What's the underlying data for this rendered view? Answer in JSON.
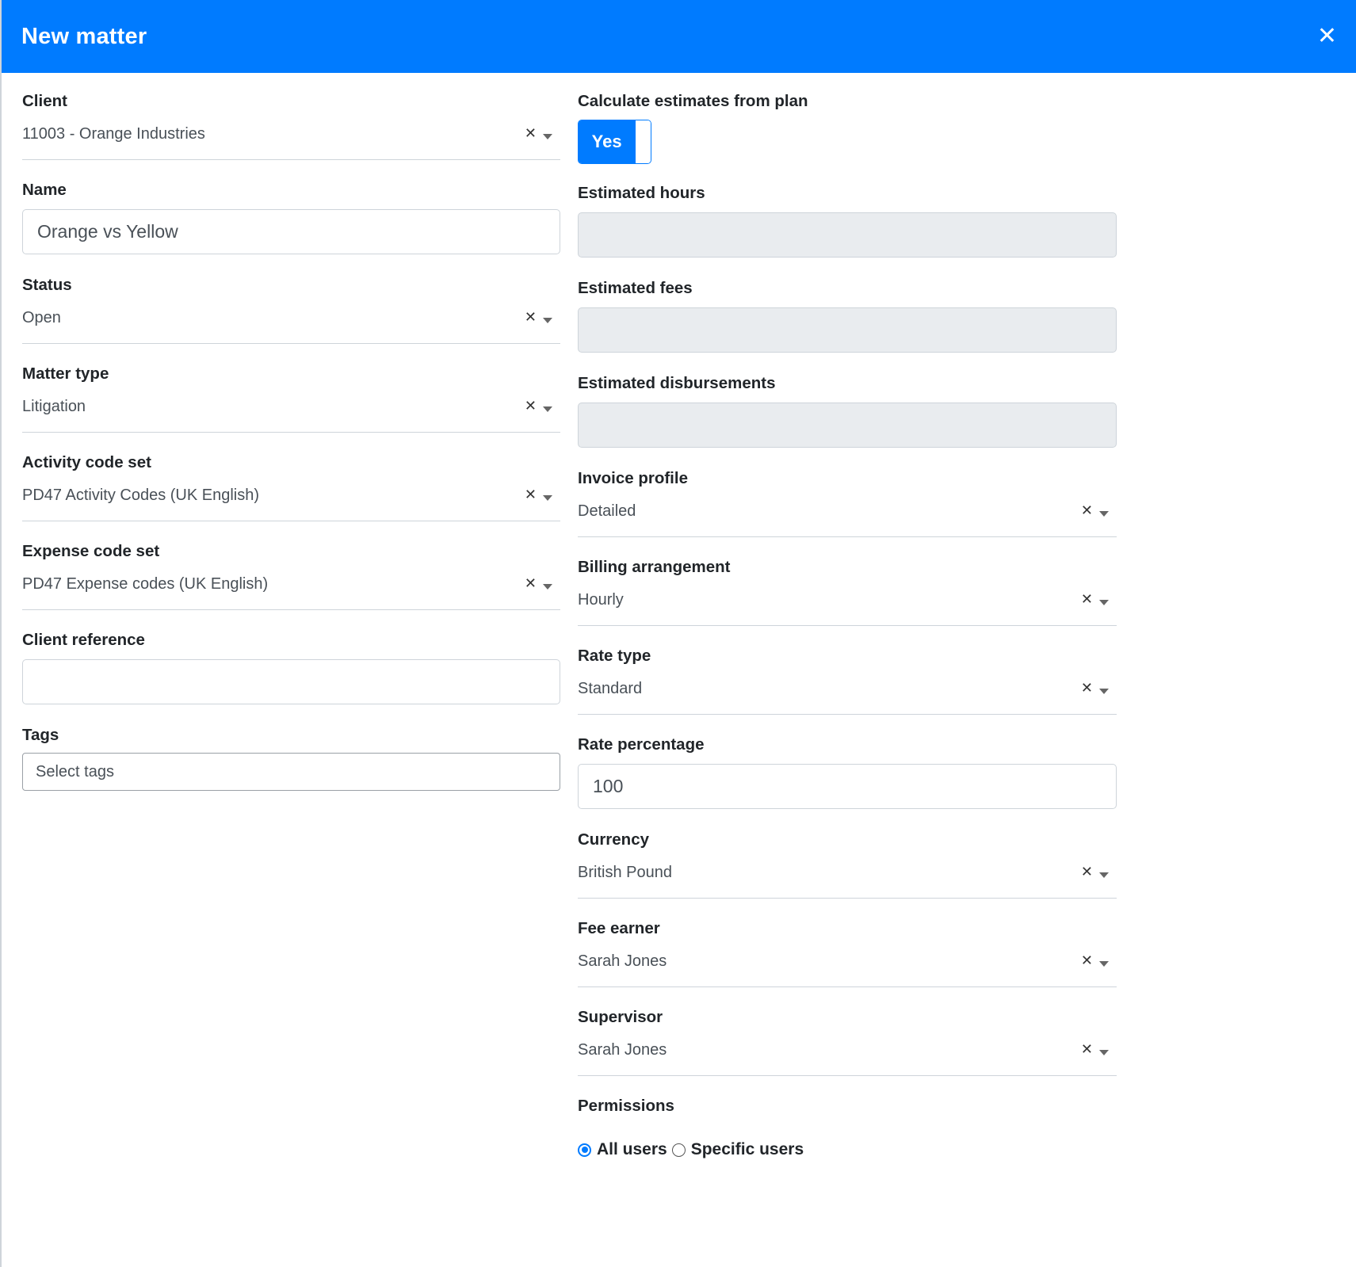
{
  "header": {
    "title": "New matter"
  },
  "left": {
    "client": {
      "label": "Client",
      "value": "11003 - Orange Industries"
    },
    "name": {
      "label": "Name",
      "value": "Orange vs Yellow"
    },
    "status": {
      "label": "Status",
      "value": "Open"
    },
    "matter_type": {
      "label": "Matter type",
      "value": "Litigation"
    },
    "activity_code_set": {
      "label": "Activity code set",
      "value": "PD47 Activity Codes (UK English)"
    },
    "expense_code_set": {
      "label": "Expense code set",
      "value": "PD47 Expense codes (UK English)"
    },
    "client_reference": {
      "label": "Client reference",
      "value": ""
    },
    "tags": {
      "label": "Tags",
      "placeholder": "Select tags"
    }
  },
  "right": {
    "calc_estimates": {
      "label": "Calculate estimates from plan",
      "toggle_label": "Yes"
    },
    "estimated_hours": {
      "label": "Estimated hours"
    },
    "estimated_fees": {
      "label": "Estimated fees"
    },
    "estimated_disbursements": {
      "label": "Estimated disbursements"
    },
    "invoice_profile": {
      "label": "Invoice profile",
      "value": "Detailed"
    },
    "billing_arrangement": {
      "label": "Billing arrangement",
      "value": "Hourly"
    },
    "rate_type": {
      "label": "Rate type",
      "value": "Standard"
    },
    "rate_percentage": {
      "label": "Rate percentage",
      "value": "100"
    },
    "currency": {
      "label": "Currency",
      "value": "British Pound"
    },
    "fee_earner": {
      "label": "Fee earner",
      "value": "Sarah Jones"
    },
    "supervisor": {
      "label": "Supervisor",
      "value": "Sarah Jones"
    },
    "permissions": {
      "label": "Permissions",
      "option_all": "All users",
      "option_specific": "Specific users",
      "selected": "All users"
    }
  },
  "icons": {
    "close": "close-icon",
    "clear": "×",
    "caret": "chevron-down-icon"
  },
  "colors": {
    "primary": "#007bff",
    "disabled_bg": "#e9ecef"
  }
}
